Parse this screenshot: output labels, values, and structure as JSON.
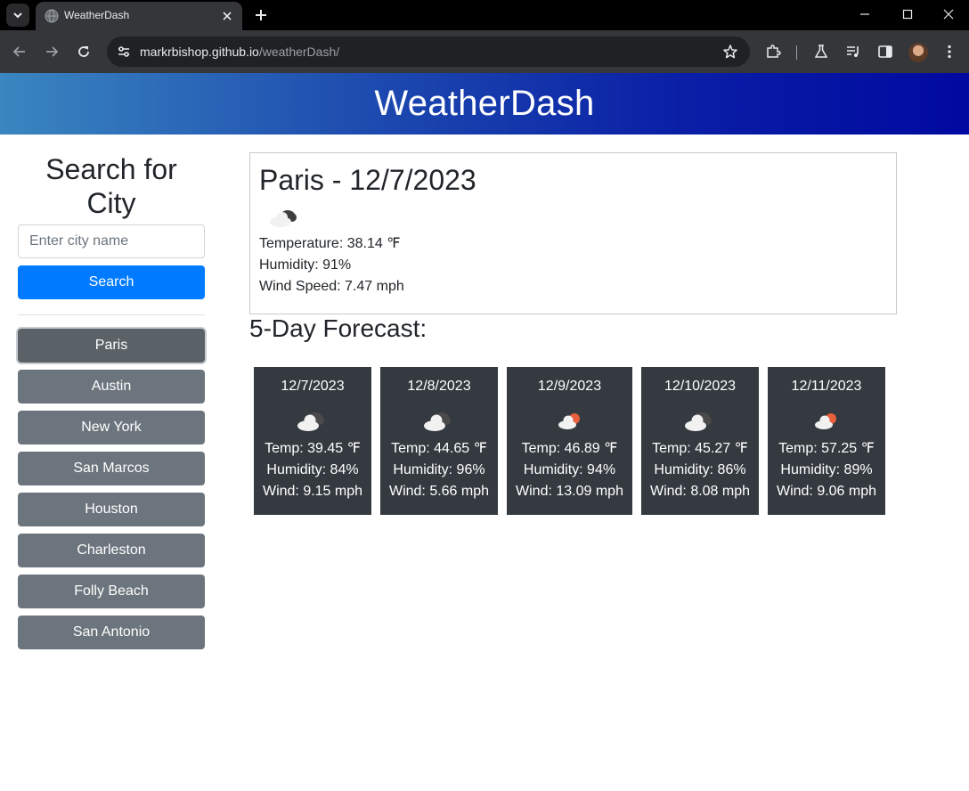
{
  "browser": {
    "tab_title": "WeatherDash",
    "url_host": "markrbishop.github.io",
    "url_path": "/weatherDash/"
  },
  "page": {
    "header_title": "WeatherDash"
  },
  "sidebar": {
    "search_title": "Search for City",
    "input_placeholder": "Enter city name",
    "input_value": "",
    "search_label": "Search",
    "history": [
      "Paris",
      "Austin",
      "New York",
      "San Marcos",
      "Houston",
      "Charleston",
      "Folly Beach",
      "San Antonio"
    ],
    "active_city": "Paris"
  },
  "current": {
    "title": "Paris - 12/7/2023",
    "icon": "cloudy-icon",
    "temperature": "Temperature: 38.14 ℉",
    "humidity": "Humidity: 91%",
    "wind": "Wind Speed: 7.47 mph"
  },
  "forecast": {
    "title": "5-Day Forecast:",
    "days": [
      {
        "date": "12/7/2023",
        "icon": "cloudy-icon",
        "temp": "Temp: 39.45 ℉",
        "humidity": "Humidity: 84%",
        "wind": "Wind: 9.15 mph"
      },
      {
        "date": "12/8/2023",
        "icon": "cloudy-icon",
        "temp": "Temp: 44.65 ℉",
        "humidity": "Humidity: 96%",
        "wind": "Wind: 5.66 mph"
      },
      {
        "date": "12/9/2023",
        "icon": "sun-cloud-icon",
        "temp": "Temp: 46.89 ℉",
        "humidity": "Humidity: 94%",
        "wind": "Wind: 13.09 mph"
      },
      {
        "date": "12/10/2023",
        "icon": "cloudy-icon",
        "temp": "Temp: 45.27 ℉",
        "humidity": "Humidity: 86%",
        "wind": "Wind: 8.08 mph"
      },
      {
        "date": "12/11/2023",
        "icon": "sun-cloud-icon",
        "temp": "Temp: 57.25 ℉",
        "humidity": "Humidity: 89%",
        "wind": "Wind: 9.06 mph"
      }
    ]
  },
  "colors": {
    "primary": "#007bff",
    "secondary": "#6c757d",
    "card_dark": "#343a40",
    "header_start": "#3a86c0",
    "header_end": "#0009a0"
  }
}
